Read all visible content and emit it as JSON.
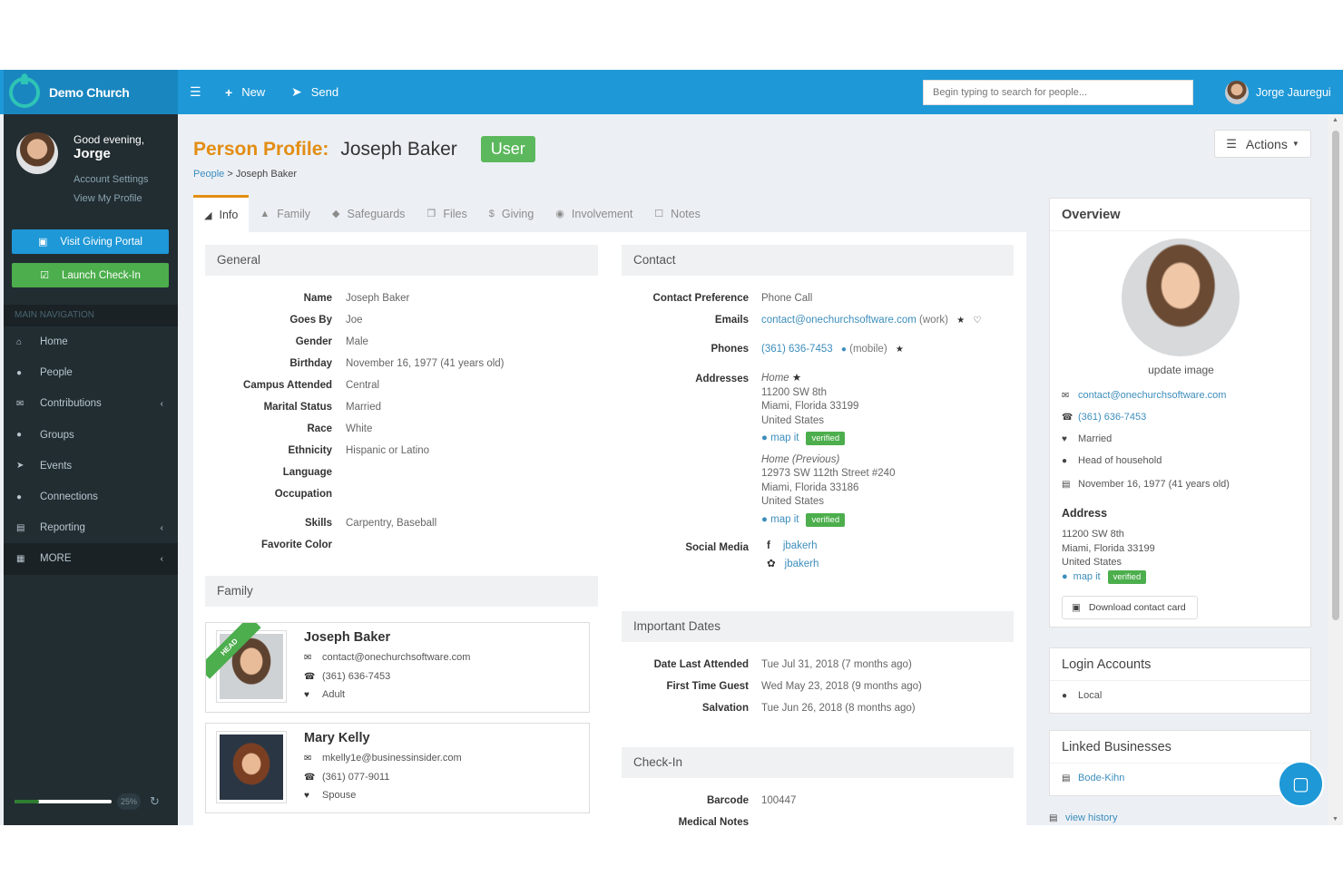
{
  "brand": {
    "name": "Demo Church"
  },
  "topbar": {
    "new_label": "New",
    "send_label": "Send",
    "search_placeholder": "Begin typing to search for people...",
    "user_name": "Jorge Jauregui"
  },
  "sidebar": {
    "greeting": "Good evening,",
    "first_name": "Jorge",
    "account_settings": "Account Settings",
    "view_profile": "View My Profile",
    "giving_button": "Visit Giving Portal",
    "checkin_button": "Launch Check-In",
    "nav_header": "MAIN NAVIGATION",
    "items": [
      {
        "label": "Home",
        "icon": "home-icon"
      },
      {
        "label": "People",
        "icon": "user-icon"
      },
      {
        "label": "Contributions",
        "icon": "envelope-icon"
      },
      {
        "label": "Groups",
        "icon": "users-icon"
      },
      {
        "label": "Events",
        "icon": "rocket-icon"
      },
      {
        "label": "Connections",
        "icon": "comments-icon"
      },
      {
        "label": "Reporting",
        "icon": "database-icon"
      },
      {
        "label": "MORE",
        "icon": "grid-icon"
      }
    ],
    "progress": 0.25,
    "progress_label": "25%"
  },
  "page": {
    "title_label": "Person Profile:",
    "person_name": "Joseph Baker",
    "user_badge": "User",
    "actions_label": "Actions",
    "breadcrumb": {
      "root": "People",
      "separator": ">",
      "current": "Joseph Baker"
    }
  },
  "tabs": [
    {
      "label": "Info",
      "icon": "folder-open-icon"
    },
    {
      "label": "Family",
      "icon": "tree-icon"
    },
    {
      "label": "Safeguards",
      "icon": "shield-icon"
    },
    {
      "label": "Files",
      "icon": "files-icon"
    },
    {
      "label": "Giving",
      "icon": "dollar-icon"
    },
    {
      "label": "Involvement",
      "icon": "globe-icon"
    },
    {
      "label": "Notes",
      "icon": "note-icon"
    }
  ],
  "general": {
    "title": "General",
    "fields": [
      {
        "label": "Name",
        "value": "Joseph Baker"
      },
      {
        "label": "Goes By",
        "value": "Joe"
      },
      {
        "label": "Gender",
        "value": "Male"
      },
      {
        "label": "Birthday",
        "value": "November 16, 1977 (41 years old)"
      },
      {
        "label": "Campus Attended",
        "value": "Central"
      },
      {
        "label": "Marital Status",
        "value": "Married"
      },
      {
        "label": "Race",
        "value": "White"
      },
      {
        "label": "Ethnicity",
        "value": "Hispanic or Latino"
      },
      {
        "label": "Language",
        "value": ""
      },
      {
        "label": "Occupation",
        "value": ""
      },
      {
        "label": "Skills",
        "value": "Carpentry, Baseball"
      },
      {
        "label": "Favorite Color",
        "value": ""
      }
    ]
  },
  "family": {
    "title": "Family",
    "members": [
      {
        "name": "Joseph Baker",
        "email": "contact@onechurchsoftware.com",
        "phone": "(361) 636-7453",
        "role": "Adult",
        "ribbon": "HEAD"
      },
      {
        "name": "Mary Kelly",
        "email": "mkelly1e@businessinsider.com",
        "phone": "(361) 077-9011",
        "role": "Spouse"
      }
    ]
  },
  "contact": {
    "title": "Contact",
    "preference_label": "Contact Preference",
    "preference": "Phone Call",
    "emails_label": "Emails",
    "email": "contact@onechurchsoftware.com",
    "email_type": "(work)",
    "phones_label": "Phones",
    "phone": "(361) 636-7453",
    "phone_type": "(mobile)",
    "addresses_label": "Addresses",
    "addresses": [
      {
        "type": "Home",
        "line1": "11200 SW 8th",
        "line2": "Miami, Florida 33199",
        "line3": "United States",
        "map": "map it",
        "verified": "verified"
      },
      {
        "type": "Home (Previous)",
        "line1": "12973 SW 112th Street #240",
        "line2": "Miami, Florida 33186",
        "line3": "United States",
        "map": "map it",
        "verified": "verified"
      }
    ],
    "social_label": "Social Media",
    "facebook": "jbakerh",
    "twitter": "jbakerh"
  },
  "dates": {
    "title": "Important Dates",
    "fields": [
      {
        "label": "Date Last Attended",
        "value": "Tue Jul 31, 2018 (7 months ago)"
      },
      {
        "label": "First Time Guest",
        "value": "Wed May 23, 2018 (9 months ago)"
      },
      {
        "label": "Salvation",
        "value": "Tue Jun 26, 2018 (8 months ago)"
      }
    ]
  },
  "checkin": {
    "title": "Check-In",
    "barcode_label": "Barcode",
    "barcode": "100447",
    "medical_label": "Medical Notes"
  },
  "overview": {
    "title": "Overview",
    "update_image": "update image",
    "email": "contact@onechurchsoftware.com",
    "phone": "(361) 636-7453",
    "marital": "Married",
    "household": "Head of household",
    "birthday": "November 16, 1977 (41 years old)",
    "address_title": "Address",
    "address_line1": "11200 SW 8th",
    "address_line2": "Miami, Florida 33199",
    "address_line3": "United States",
    "map": "map it",
    "verified": "verified",
    "download": "Download contact card"
  },
  "login": {
    "title": "Login Accounts",
    "item": "Local"
  },
  "linked": {
    "title": "Linked Businesses",
    "item": "Bode-Kihn",
    "history": "view history"
  }
}
